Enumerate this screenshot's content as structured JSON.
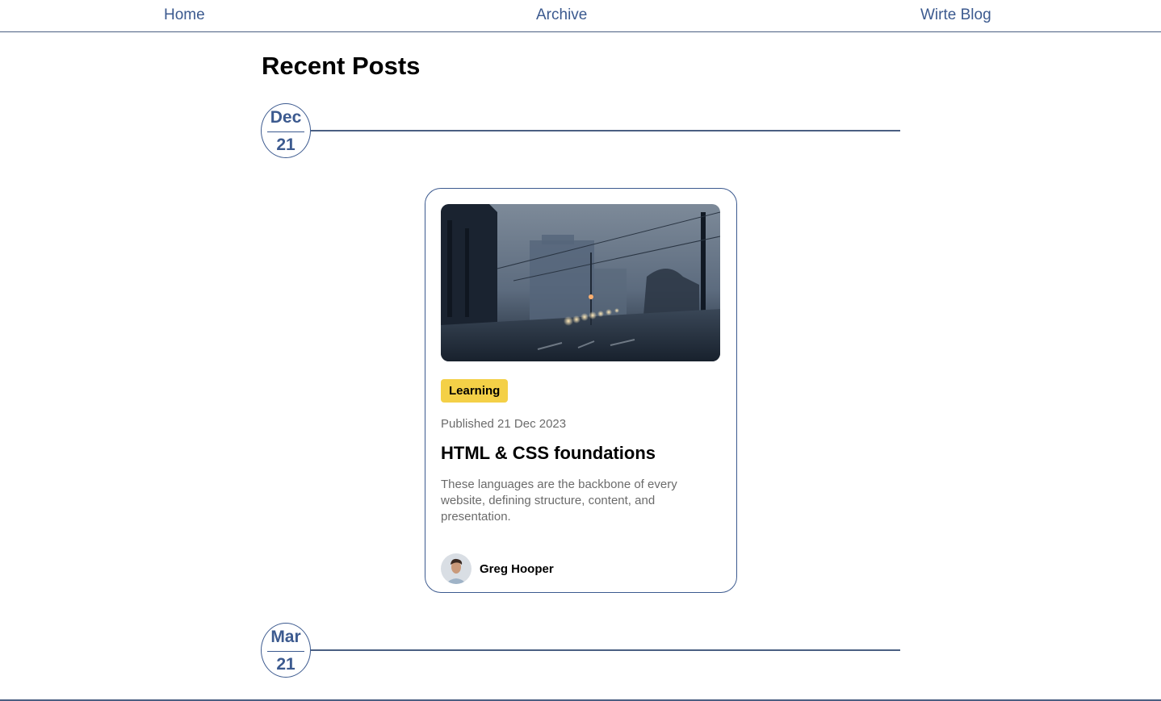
{
  "nav": {
    "home": "Home",
    "archive": "Archive",
    "write": "Wirte Blog"
  },
  "page_title": "Recent Posts",
  "sections": [
    {
      "month": "Dec",
      "day": "21",
      "post": {
        "tag": "Learning",
        "published": "Published 21 Dec 2023",
        "title": "HTML & CSS foundations",
        "excerpt": "These languages are the backbone of every website, defining structure, content, and presentation.",
        "author": "Greg Hooper"
      }
    },
    {
      "month": "Mar",
      "day": "21"
    }
  ],
  "colors": {
    "accent": "#3c5a8f",
    "tag_background": "#f4d047",
    "muted_text": "#6b6b6b"
  }
}
